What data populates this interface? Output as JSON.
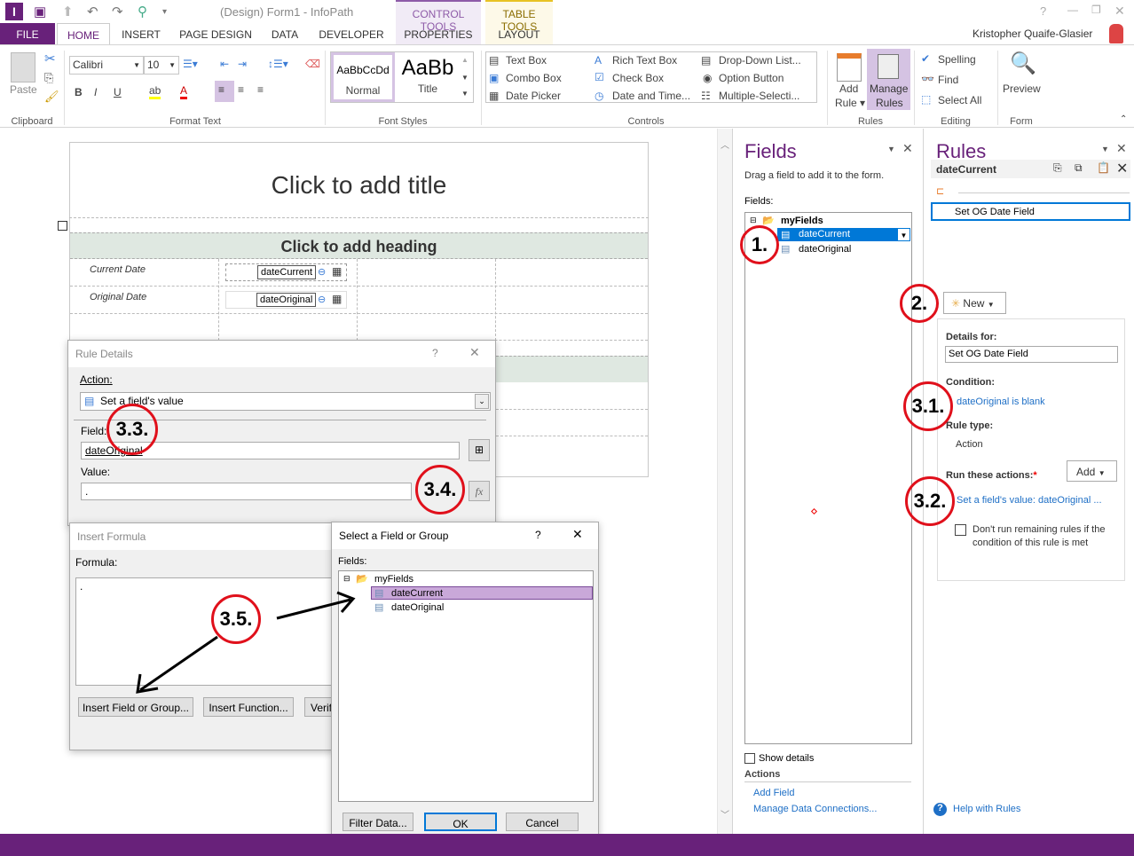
{
  "app": {
    "title": "(Design) Form1 - InfoPath",
    "user": "Kristopher Quaife-Glasier",
    "help": "?",
    "restore": "❐",
    "close": "✕",
    "minimize": "—"
  },
  "qat": {
    "logo": "I",
    "save": "💾",
    "undo": "↶",
    "redo": "↷",
    "preview": "⚲",
    "more": "▾"
  },
  "tabs": {
    "file": "FILE",
    "home": "HOME",
    "insert": "INSERT",
    "page_design": "PAGE DESIGN",
    "data": "DATA",
    "developer": "DEVELOPER",
    "control_tools": "CONTROL TOOLS",
    "properties": "PROPERTIES",
    "table_tools": "TABLE TOOLS",
    "layout": "LAYOUT"
  },
  "colors": {
    "brand": "#68217a",
    "control_tools": "#8e5ba8",
    "table_tools": "#e8c224",
    "annotation": "#e0101b",
    "link": "#1e6fc6"
  },
  "ribbon": {
    "clipboard": {
      "paste": "Paste",
      "group": "Clipboard"
    },
    "format_text": {
      "font": "Calibri",
      "size": "10",
      "bold": "B",
      "italic": "I",
      "underline": "U",
      "group": "Format Text"
    },
    "font_styles": {
      "normal_preview": "AaBbCcDd",
      "normal": "Normal",
      "title_preview": "AaBb",
      "title": "Title",
      "group": "Font Styles"
    },
    "controls": {
      "items": [
        "Text Box",
        "Combo Box",
        "Date Picker",
        "Rich Text Box",
        "Check Box",
        "Date and Time...",
        "Drop-Down List...",
        "Option Button",
        "Multiple-Selecti..."
      ],
      "group": "Controls"
    },
    "rules": {
      "add_rule": "Add",
      "add_rule2": "Rule ▾",
      "manage": "Manage",
      "manage2": "Rules",
      "group": "Rules"
    },
    "editing": {
      "spelling": "Spelling",
      "find": "Find",
      "select_all": "Select All",
      "group": "Editing"
    },
    "form": {
      "preview": "Preview",
      "group": "Form"
    }
  },
  "form": {
    "title": "Click to add title",
    "heading": "Click to add heading",
    "rows": [
      {
        "label": "Current Date",
        "field": "dateCurrent"
      },
      {
        "label": "Original Date",
        "field": "dateOriginal"
      }
    ]
  },
  "fields_pane": {
    "title": "Fields",
    "hint": "Drag a field to add it to the form.",
    "label": "Fields:",
    "root": "myFields",
    "items": [
      "dateCurrent",
      "dateOriginal"
    ],
    "show_details": "Show details",
    "actions": "Actions",
    "add_field": "Add Field",
    "manage_connections": "Manage Data Connections..."
  },
  "rules_pane": {
    "title": "Rules",
    "field": "dateCurrent",
    "rule_name": "Set OG Date Field",
    "new": "New",
    "details_for": "Details for:",
    "details_value": "Set OG Date Field",
    "condition": "Condition:",
    "condition_value": "dateOriginal is blank",
    "rule_type": "Rule type:",
    "rule_type_value": "Action",
    "run_actions": "Run these actions:",
    "required": "*",
    "add": "Add",
    "action_link": "Set a field's value: dateOriginal ...",
    "dont_run": "Don't run remaining rules if the condition of this rule is met",
    "help": "Help with Rules"
  },
  "rule_details": {
    "title": "Rule Details",
    "help": "?",
    "action_label": "Action:",
    "action_value": "Set a field's value",
    "field_label": "Field:",
    "field_value": "dateOriginal",
    "value_label": "Value:",
    "value_value": ".",
    "fx": "fx"
  },
  "insert_formula": {
    "title": "Insert Formula",
    "formula_label": "Formula:",
    "formula_value": ".",
    "insert_field": "Insert Field or Group...",
    "insert_function": "Insert Function...",
    "verify": "Verify"
  },
  "select_field": {
    "title": "Select a Field or Group",
    "help": "?",
    "fields_label": "Fields:",
    "root": "myFields",
    "items": [
      "dateCurrent",
      "dateOriginal"
    ],
    "filter": "Filter Data...",
    "ok": "OK",
    "cancel": "Cancel"
  },
  "annotations": [
    "1.",
    "2.",
    "3.1.",
    "3.2.",
    "3.3.",
    "3.4.",
    "3.5."
  ]
}
